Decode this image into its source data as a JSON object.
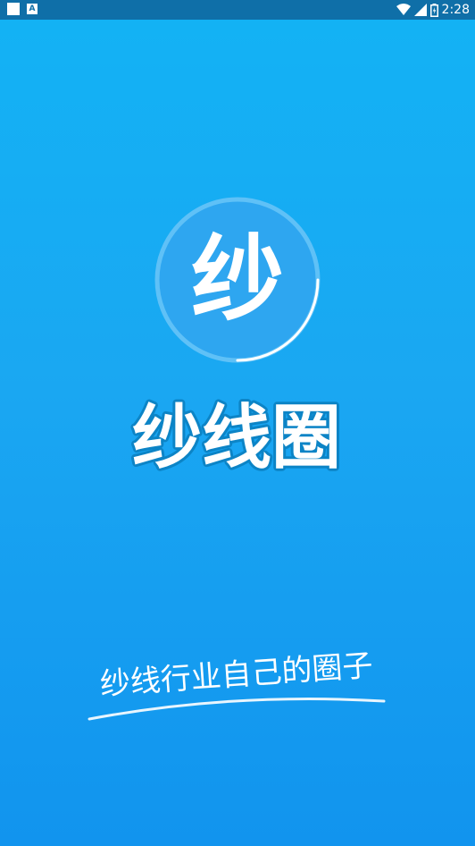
{
  "status_bar": {
    "time": "2:28",
    "notification_icons": [
      "square-icon",
      "a-letter-icon"
    ],
    "system_icons": [
      "wifi-icon",
      "signal-icon",
      "battery-icon"
    ],
    "a_icon_text": "A"
  },
  "splash": {
    "logo_glyph": "纱",
    "app_name": "纱线圈",
    "slogan": "纱线行业自己的圈子"
  },
  "colors": {
    "status_bar": "#0f6fa8",
    "background_top": "#13b2f4",
    "background_bottom": "#1194ee",
    "logo_circle": "#2ea6f0",
    "text": "#ffffff"
  }
}
